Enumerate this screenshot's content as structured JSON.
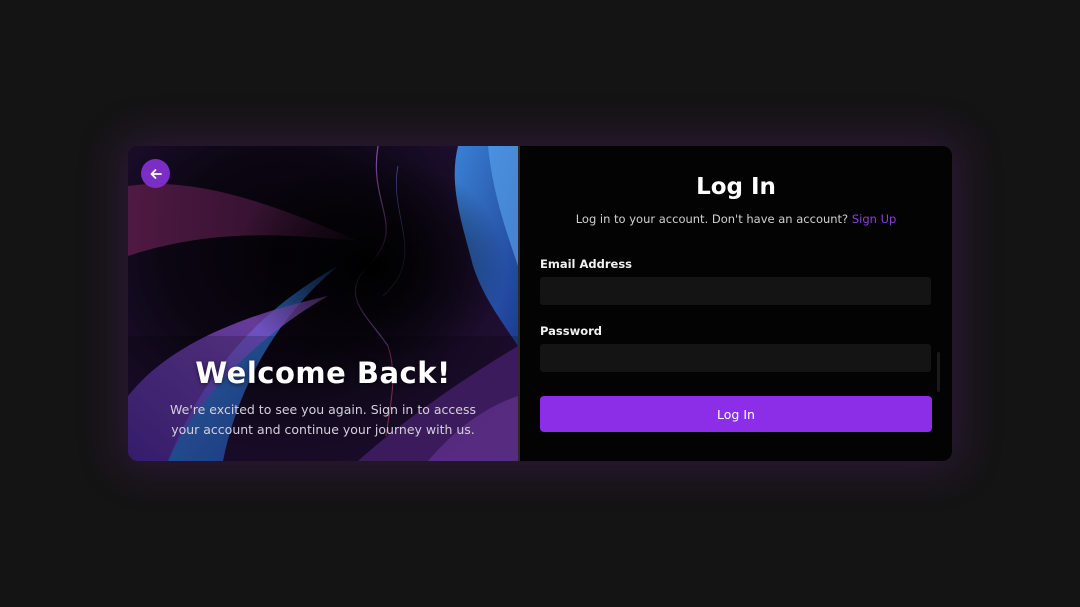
{
  "welcome": {
    "title": "Welcome Back!",
    "text": "We're excited to see you again. Sign in to access your account and continue your journey with us."
  },
  "back_button": {
    "icon": "arrow-left-icon"
  },
  "login": {
    "title": "Log In",
    "subtitle_prefix": "Log in to your account. Don't have an account?",
    "signup_link": "Sign Up",
    "email_label": "Email Address",
    "email_value": "",
    "password_label": "Password",
    "password_value": "",
    "submit_label": "Log In"
  },
  "colors": {
    "accent": "#8c2ee8",
    "link": "#8a3fe0",
    "background": "#141414",
    "panel": "#030303",
    "input": "#141414"
  }
}
